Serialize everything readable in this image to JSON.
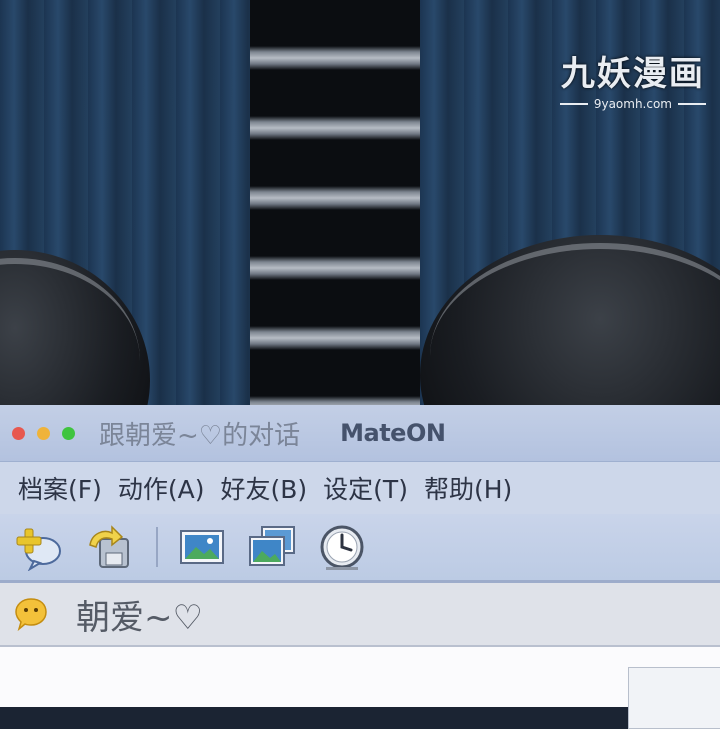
{
  "watermark": {
    "title": "九妖漫画",
    "url": "9yaomh.com"
  },
  "window": {
    "title": "跟朝爱~♡的对话",
    "app_name": "MateON",
    "traffic_lights": [
      "close",
      "minimize",
      "zoom"
    ]
  },
  "menu": {
    "items": [
      {
        "label": "档案(F)"
      },
      {
        "label": "动作(A)"
      },
      {
        "label": "好友(B)"
      },
      {
        "label": "设定(T)"
      },
      {
        "label": "帮助(H)"
      }
    ]
  },
  "toolbar": {
    "icons": [
      "add-contact-icon",
      "transfer-file-icon",
      "picture-icon",
      "pictures-icon",
      "clock-icon"
    ]
  },
  "contact": {
    "name": "朝爱~♡",
    "status_icon": "emoticon-icon"
  },
  "colors": {
    "titlebar": "#b3c2df",
    "menubar": "#cdd7ea",
    "contactbar": "#dfe2e9",
    "chat": "#fbfbfd"
  }
}
